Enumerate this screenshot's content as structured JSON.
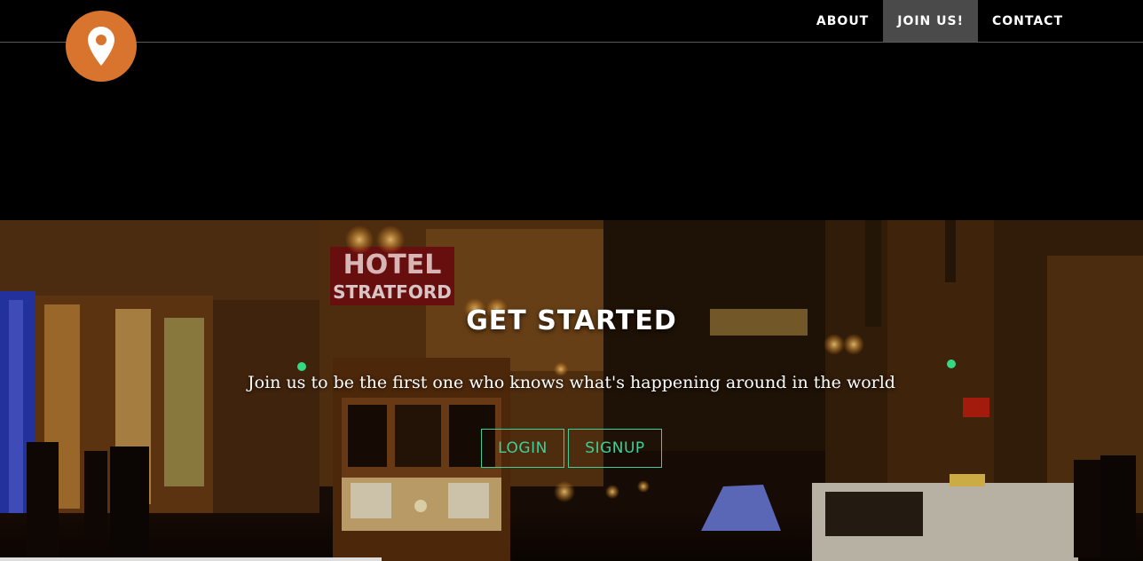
{
  "nav": {
    "logo_icon": "map-marker-icon",
    "items": [
      {
        "label": "ABOUT",
        "active": false
      },
      {
        "label": "JOIN US!",
        "active": true
      },
      {
        "label": "CONTACT",
        "active": false
      }
    ]
  },
  "hero": {
    "title": "GET STARTED",
    "subtitle": "Join us to be the first one who knows what's happening around in the world",
    "login_label": "LOGIN",
    "signup_label": "SIGNUP",
    "background_image": "night street with hotel stratford sign and cable car",
    "sign_hotel_line1": "HOTEL",
    "sign_hotel_line2": "STRATFORD"
  },
  "colors": {
    "logo_bg": "#d9742f",
    "button_accent": "#3ecf9a",
    "nav_active_bg": "#4a4a4a"
  }
}
